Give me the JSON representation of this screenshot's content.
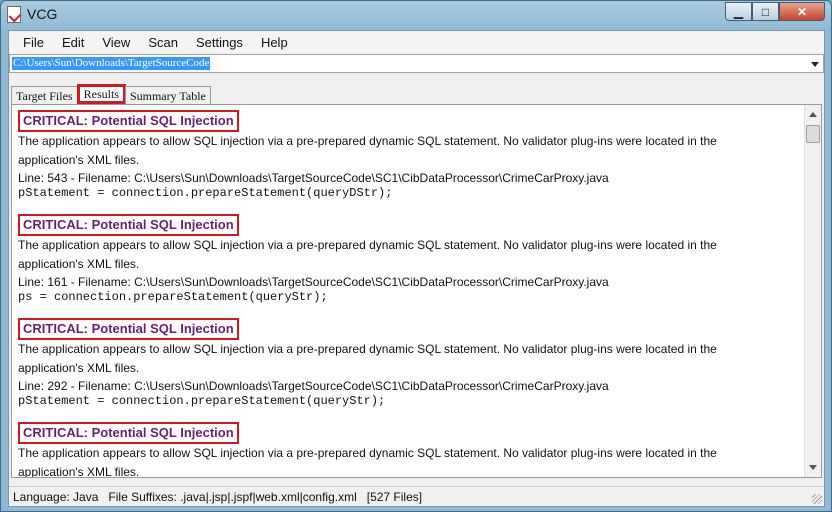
{
  "window": {
    "title": "VCG"
  },
  "menu": [
    "File",
    "Edit",
    "View",
    "Scan",
    "Settings",
    "Help"
  ],
  "path": "C:\\Users\\Sun\\Downloads\\TargetSourceCode",
  "tabs": [
    {
      "label": "Target Files",
      "active": false
    },
    {
      "label": "Results",
      "active": true
    },
    {
      "label": "Summary Table",
      "active": false
    }
  ],
  "findings": [
    {
      "title": "CRITICAL: Potential SQL Injection",
      "desc": "The application appears to allow SQL injection via a pre-prepared dynamic SQL statement. No validator plug-ins were located in the application's XML files.",
      "line": "Line: 543 - Filename: C:\\Users\\Sun\\Downloads\\TargetSourceCode\\SC1\\CibDataProcessor\\CrimeCarProxy.java",
      "code": "pStatement = connection.prepareStatement(queryDStr);"
    },
    {
      "title": "CRITICAL: Potential SQL Injection",
      "desc": "The application appears to allow SQL injection via a pre-prepared dynamic SQL statement. No validator plug-ins were located in the application's XML files.",
      "line": "Line: 161 - Filename: C:\\Users\\Sun\\Downloads\\TargetSourceCode\\SC1\\CibDataProcessor\\CrimeCarProxy.java",
      "code": "ps = connection.prepareStatement(queryStr);"
    },
    {
      "title": "CRITICAL: Potential SQL Injection",
      "desc": "The application appears to allow SQL injection via a pre-prepared dynamic SQL statement. No validator plug-ins were located in the application's XML files.",
      "line": "Line: 292 - Filename: C:\\Users\\Sun\\Downloads\\TargetSourceCode\\SC1\\CibDataProcessor\\CrimeCarProxy.java",
      "code": "pStatement = connection.prepareStatement(queryStr);"
    },
    {
      "title": "CRITICAL: Potential SQL Injection",
      "desc": "The application appears to allow SQL injection via a pre-prepared dynamic SQL statement. No validator plug-ins were located in the application's XML files.",
      "line": "",
      "code": ""
    }
  ],
  "status": "Language: Java   File Suffixes: .java|.jsp|.jspf|web.xml|config.xml   [527 Files]",
  "colors": {
    "critical_title": "#6c1f72",
    "highlight_border": "#d4181f",
    "selection": "#3399ff"
  }
}
